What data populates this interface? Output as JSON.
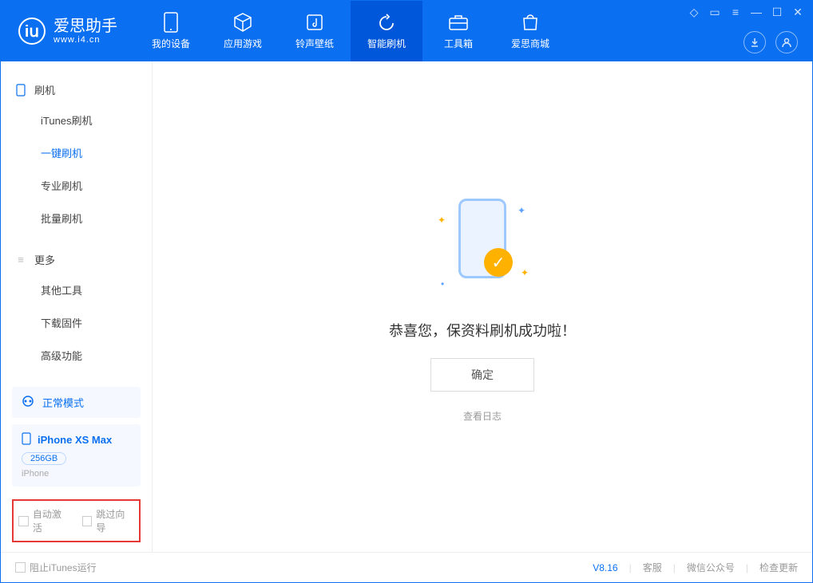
{
  "app": {
    "title": "爱思助手",
    "subtitle": "www.i4.cn"
  },
  "tabs": [
    {
      "label": "我的设备"
    },
    {
      "label": "应用游戏"
    },
    {
      "label": "铃声壁纸"
    },
    {
      "label": "智能刷机"
    },
    {
      "label": "工具箱"
    },
    {
      "label": "爱思商城"
    }
  ],
  "sidebar": {
    "group1": {
      "title": "刷机",
      "items": [
        "iTunes刷机",
        "一键刷机",
        "专业刷机",
        "批量刷机"
      ]
    },
    "group2": {
      "title": "更多",
      "items": [
        "其他工具",
        "下载固件",
        "高级功能"
      ]
    }
  },
  "mode": {
    "label": "正常模式"
  },
  "device": {
    "name": "iPhone XS Max",
    "storage": "256GB",
    "type": "iPhone"
  },
  "options": {
    "auto_activate": "自动激活",
    "skip_guide": "跳过向导"
  },
  "main": {
    "success_text": "恭喜您，保资料刷机成功啦！",
    "confirm": "确定",
    "view_log": "查看日志"
  },
  "footer": {
    "block_itunes": "阻止iTunes运行",
    "version": "V8.16",
    "links": [
      "客服",
      "微信公众号",
      "检查更新"
    ]
  }
}
